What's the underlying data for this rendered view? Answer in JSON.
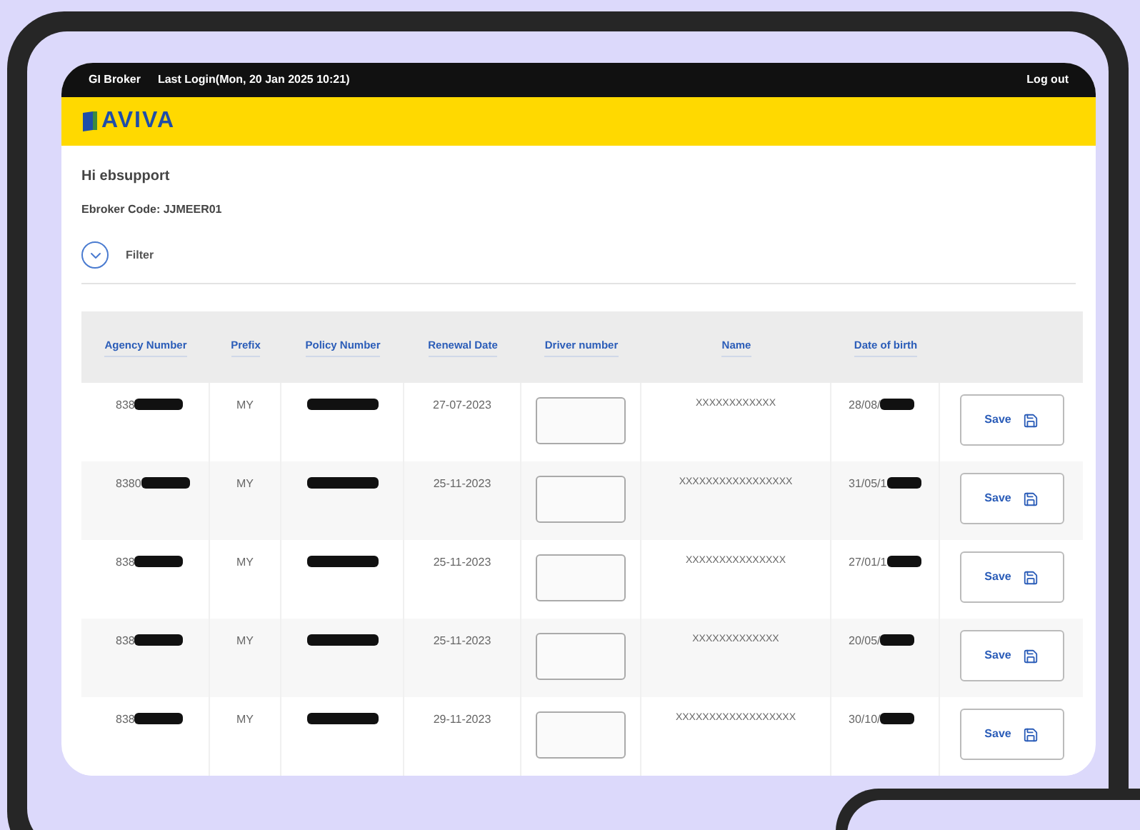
{
  "top_bar": {
    "broker": "GI Broker",
    "last_login": "Last Login(Mon, 20 Jan 2025 10:21)",
    "logout": "Log out"
  },
  "logo": "AVIVA",
  "greeting": "Hi ebsupport",
  "broker_code": "Ebroker Code: JJMEER01",
  "filter": {
    "label": "Filter",
    "expanded": false
  },
  "table": {
    "columns": [
      "Agency Number",
      "Prefix",
      "Policy Number",
      "Renewal Date",
      "Driver number",
      "Name",
      "Date of birth"
    ],
    "rows": [
      {
        "agency_number": "838",
        "prefix": "MY",
        "renewal_date": "27-07-2023",
        "name": "XXXXXXXXXXXX",
        "date_of_birth": "28/08/",
        "save": "Save"
      },
      {
        "agency_number": "8380",
        "prefix": "MY",
        "renewal_date": "25-11-2023",
        "name": "XXXXXXXXXXXXXXXXX",
        "date_of_birth": "31/05/1",
        "save": "Save"
      },
      {
        "agency_number": "838",
        "prefix": "MY",
        "renewal_date": "25-11-2023",
        "name": "XXXXXXXXXXXXXXX",
        "date_of_birth": "27/01/1",
        "save": "Save"
      },
      {
        "agency_number": "838",
        "prefix": "MY",
        "renewal_date": "25-11-2023",
        "name": "XXXXXXXXXXXXX",
        "date_of_birth": "20/05/",
        "save": "Save"
      },
      {
        "agency_number": "838",
        "prefix": "MY",
        "renewal_date": "29-11-2023",
        "name": "XXXXXXXXXXXXXXXXXX",
        "date_of_birth": "30/10/",
        "save": "Save"
      }
    ]
  }
}
